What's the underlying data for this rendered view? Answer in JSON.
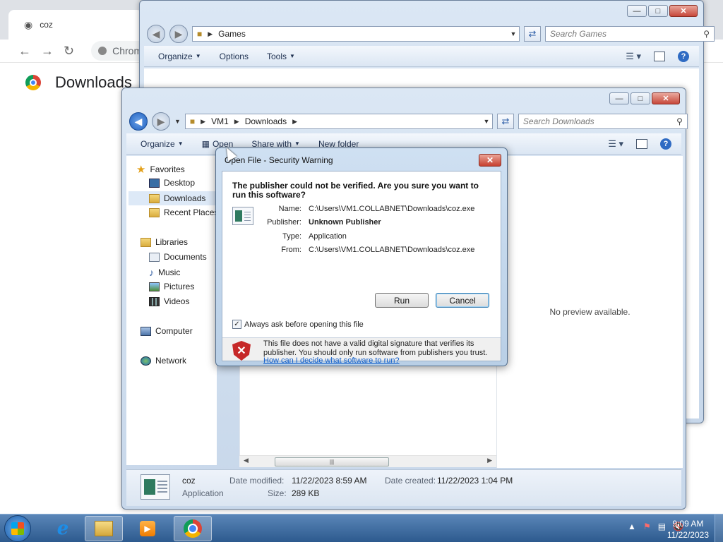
{
  "chrome": {
    "tab_title": "coz",
    "omnibox_text": "Chrom",
    "page_title": "Downloads"
  },
  "games_window": {
    "path": [
      "Games"
    ],
    "search_placeholder": "Search Games",
    "commands": [
      "Organize",
      "Options",
      "Tools"
    ]
  },
  "downloads_window": {
    "path": [
      "VM1",
      "Downloads"
    ],
    "search_placeholder": "Search Downloads",
    "commands": [
      "Organize",
      "Open",
      "Share with",
      "New folder"
    ],
    "nav": {
      "favorites": "Favorites",
      "desktop": "Desktop",
      "downloads": "Downloads",
      "recent": "Recent Places",
      "libraries": "Libraries",
      "documents": "Documents",
      "music": "Music",
      "pictures": "Pictures",
      "videos": "Videos",
      "computer": "Computer",
      "network": "Network"
    },
    "preview_text": "No preview available.",
    "details": {
      "name": "coz",
      "type": "Application",
      "modified_label": "Date modified:",
      "modified": "11/22/2023 8:59 AM",
      "size_label": "Size:",
      "size": "289 KB",
      "created_label": "Date created:",
      "created": "11/22/2023 1:04 PM"
    }
  },
  "dialog": {
    "title": "Open File - Security Warning",
    "heading": "The publisher could not be verified.  Are you sure you want to run this software?",
    "fields": {
      "name_label": "Name:",
      "name": "C:\\Users\\VM1.COLLABNET\\Downloads\\coz.exe",
      "publisher_label": "Publisher:",
      "publisher": "Unknown Publisher",
      "type_label": "Type:",
      "type": "Application",
      "from_label": "From:",
      "from": "C:\\Users\\VM1.COLLABNET\\Downloads\\coz.exe"
    },
    "run_label": "Run",
    "cancel_label": "Cancel",
    "checkbox_label": "Always ask before opening this file",
    "checkbox_checked": true,
    "warning_text": "This file does not have a valid digital signature that verifies its publisher.  You should only run software from publishers you trust.",
    "warning_link": "How can I decide what software to run?"
  },
  "taskbar": {
    "time": "9:09 AM",
    "date": "11/22/2023"
  }
}
